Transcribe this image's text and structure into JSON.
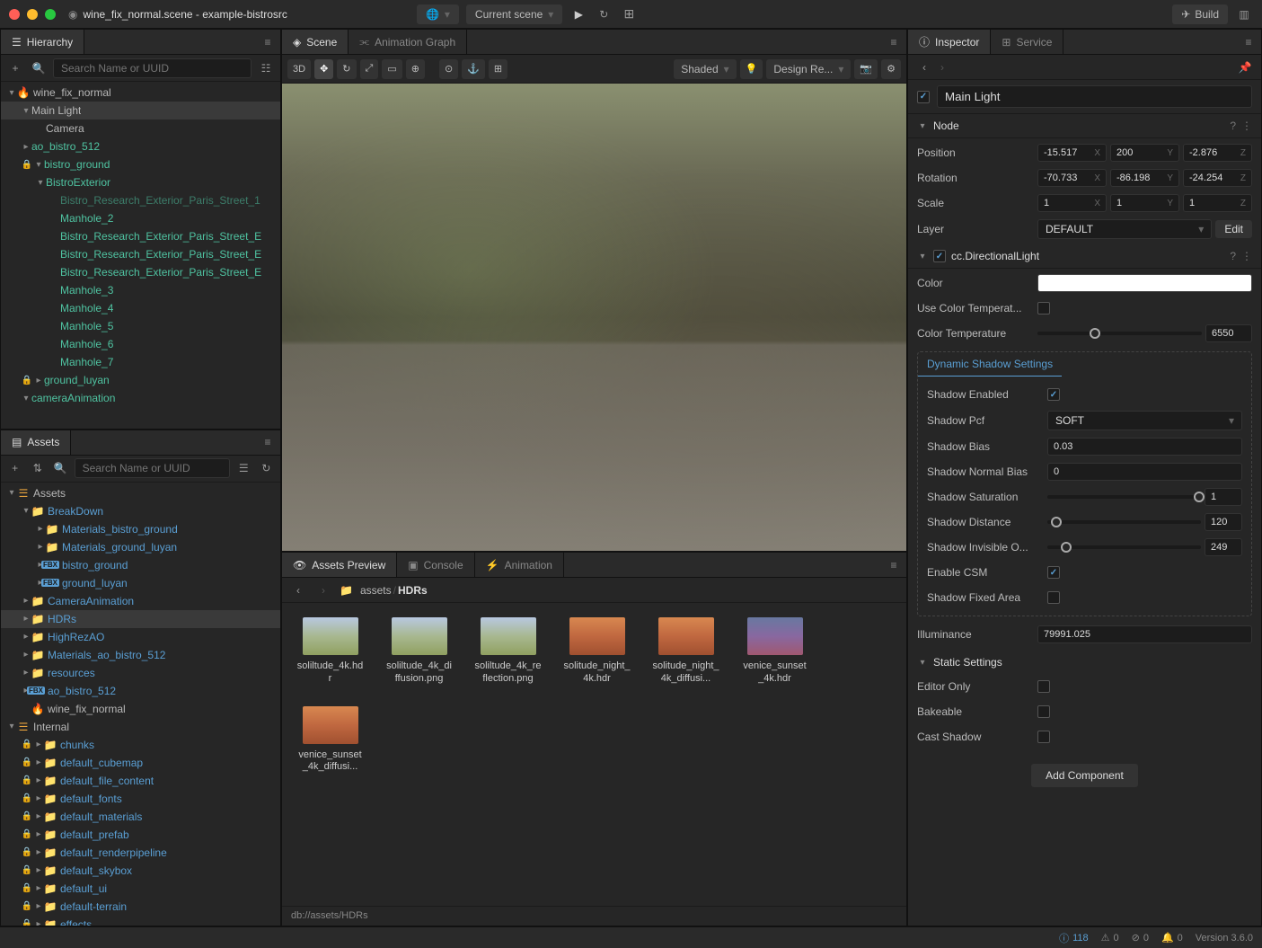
{
  "titlebar": {
    "filename": "wine_fix_normal.scene - example-bistrosrc",
    "scene_dd": "Current scene",
    "build": "Build"
  },
  "hierarchy": {
    "title": "Hierarchy",
    "search_placeholder": "Search Name or UUID",
    "items": [
      {
        "label": "wine_fix_normal",
        "depth": 0,
        "caret": "v",
        "icon": "flame",
        "color": ""
      },
      {
        "label": "Main Light",
        "depth": 1,
        "caret": "v",
        "icon": "",
        "color": "",
        "selected": true
      },
      {
        "label": "Camera",
        "depth": 2,
        "caret": "",
        "icon": "",
        "color": ""
      },
      {
        "label": "ao_bistro_512",
        "depth": 1,
        "caret": ">",
        "icon": "",
        "color": "teal"
      },
      {
        "label": "bistro_ground",
        "depth": 1,
        "caret": "v",
        "icon": "",
        "color": "teal",
        "lock": true
      },
      {
        "label": "BistroExterior",
        "depth": 2,
        "caret": "v",
        "icon": "",
        "color": "teal"
      },
      {
        "label": "Bistro_Research_Exterior_Paris_Street_1",
        "depth": 3,
        "caret": "",
        "icon": "",
        "color": "teal dim"
      },
      {
        "label": "Manhole_2",
        "depth": 3,
        "caret": "",
        "icon": "",
        "color": "teal"
      },
      {
        "label": "Bistro_Research_Exterior_Paris_Street_E",
        "depth": 3,
        "caret": "",
        "icon": "",
        "color": "teal"
      },
      {
        "label": "Bistro_Research_Exterior_Paris_Street_E",
        "depth": 3,
        "caret": "",
        "icon": "",
        "color": "teal"
      },
      {
        "label": "Bistro_Research_Exterior_Paris_Street_E",
        "depth": 3,
        "caret": "",
        "icon": "",
        "color": "teal"
      },
      {
        "label": "Manhole_3",
        "depth": 3,
        "caret": "",
        "icon": "",
        "color": "teal"
      },
      {
        "label": "Manhole_4",
        "depth": 3,
        "caret": "",
        "icon": "",
        "color": "teal"
      },
      {
        "label": "Manhole_5",
        "depth": 3,
        "caret": "",
        "icon": "",
        "color": "teal"
      },
      {
        "label": "Manhole_6",
        "depth": 3,
        "caret": "",
        "icon": "",
        "color": "teal"
      },
      {
        "label": "Manhole_7",
        "depth": 3,
        "caret": "",
        "icon": "",
        "color": "teal"
      },
      {
        "label": "ground_luyan",
        "depth": 1,
        "caret": ">",
        "icon": "",
        "color": "teal",
        "lock": true
      },
      {
        "label": "cameraAnimation",
        "depth": 1,
        "caret": "v",
        "icon": "",
        "color": "teal"
      }
    ]
  },
  "assets": {
    "title": "Assets",
    "search_placeholder": "Search Name or UUID",
    "items": [
      {
        "label": "Assets",
        "depth": 0,
        "caret": "v",
        "icon": "db",
        "color": ""
      },
      {
        "label": "BreakDown",
        "depth": 1,
        "caret": "v",
        "icon": "folder",
        "color": "blue"
      },
      {
        "label": "Materials_bistro_ground",
        "depth": 2,
        "caret": ">",
        "icon": "folder",
        "color": "blue"
      },
      {
        "label": "Materials_ground_luyan",
        "depth": 2,
        "caret": ">",
        "icon": "folder",
        "color": "blue"
      },
      {
        "label": "bistro_ground",
        "depth": 2,
        "caret": ">",
        "icon": "fbx",
        "color": "blue"
      },
      {
        "label": "ground_luyan",
        "depth": 2,
        "caret": ">",
        "icon": "fbx",
        "color": "blue"
      },
      {
        "label": "CameraAnimation",
        "depth": 1,
        "caret": ">",
        "icon": "folder",
        "color": "blue"
      },
      {
        "label": "HDRs",
        "depth": 1,
        "caret": ">",
        "icon": "folder",
        "color": "blue",
        "selected": true
      },
      {
        "label": "HighRezAO",
        "depth": 1,
        "caret": ">",
        "icon": "folder",
        "color": "blue"
      },
      {
        "label": "Materials_ao_bistro_512",
        "depth": 1,
        "caret": ">",
        "icon": "folder",
        "color": "blue"
      },
      {
        "label": "resources",
        "depth": 1,
        "caret": ">",
        "icon": "folder",
        "color": "blue"
      },
      {
        "label": "ao_bistro_512",
        "depth": 1,
        "caret": ">",
        "icon": "fbx",
        "color": "blue"
      },
      {
        "label": "wine_fix_normal",
        "depth": 1,
        "caret": "",
        "icon": "flame",
        "color": ""
      },
      {
        "label": "Internal",
        "depth": 0,
        "caret": "v",
        "icon": "db",
        "color": ""
      },
      {
        "label": "chunks",
        "depth": 1,
        "caret": ">",
        "icon": "folder",
        "color": "blue",
        "lock": true
      },
      {
        "label": "default_cubemap",
        "depth": 1,
        "caret": ">",
        "icon": "folder",
        "color": "blue",
        "lock": true
      },
      {
        "label": "default_file_content",
        "depth": 1,
        "caret": ">",
        "icon": "folder",
        "color": "blue",
        "lock": true
      },
      {
        "label": "default_fonts",
        "depth": 1,
        "caret": ">",
        "icon": "folder",
        "color": "blue",
        "lock": true
      },
      {
        "label": "default_materials",
        "depth": 1,
        "caret": ">",
        "icon": "folder",
        "color": "blue",
        "lock": true
      },
      {
        "label": "default_prefab",
        "depth": 1,
        "caret": ">",
        "icon": "folder",
        "color": "blue",
        "lock": true
      },
      {
        "label": "default_renderpipeline",
        "depth": 1,
        "caret": ">",
        "icon": "folder",
        "color": "blue",
        "lock": true
      },
      {
        "label": "default_skybox",
        "depth": 1,
        "caret": ">",
        "icon": "folder",
        "color": "blue",
        "lock": true
      },
      {
        "label": "default_ui",
        "depth": 1,
        "caret": ">",
        "icon": "folder",
        "color": "blue",
        "lock": true
      },
      {
        "label": "default-terrain",
        "depth": 1,
        "caret": ">",
        "icon": "folder",
        "color": "blue",
        "lock": true
      },
      {
        "label": "effects",
        "depth": 1,
        "caret": ">",
        "icon": "folder",
        "color": "blue",
        "lock": true
      }
    ]
  },
  "center": {
    "tabs": {
      "scene": "Scene",
      "anim_graph": "Animation Graph"
    },
    "tool_3d": "3D",
    "shaded": "Shaded",
    "design": "Design Re...",
    "preview_tabs": {
      "preview": "Assets Preview",
      "console": "Console",
      "animation": "Animation"
    },
    "breadcrumb": [
      "assets",
      "HDRs"
    ],
    "grid": [
      {
        "name": "soliltude_4k.hdr",
        "thumb": "day"
      },
      {
        "name": "soliltude_4k_diffusion.png",
        "thumb": "day"
      },
      {
        "name": "soliltude_4k_reflection.png",
        "thumb": "day"
      },
      {
        "name": "solitude_night_4k.hdr",
        "thumb": "sunset"
      },
      {
        "name": "solitude_night_4k_diffusi...",
        "thumb": "sunset"
      },
      {
        "name": "venice_sunset_4k.hdr",
        "thumb": "dusk"
      },
      {
        "name": "venice_sunset_4k_diffusi...",
        "thumb": "sunset"
      }
    ],
    "path": "db://assets/HDRs"
  },
  "inspector": {
    "tabs": {
      "inspector": "Inspector",
      "service": "Service"
    },
    "name": "Main Light",
    "node_title": "Node",
    "position": {
      "label": "Position",
      "x": "-15.517",
      "y": "200",
      "z": "-2.876"
    },
    "rotation": {
      "label": "Rotation",
      "x": "-70.733",
      "y": "-86.198",
      "z": "-24.254"
    },
    "scale": {
      "label": "Scale",
      "x": "1",
      "y": "1",
      "z": "1"
    },
    "layer": {
      "label": "Layer",
      "value": "DEFAULT",
      "edit": "Edit"
    },
    "component": "cc.DirectionalLight",
    "color_label": "Color",
    "use_color_temp": "Use Color Temperat...",
    "color_temp": {
      "label": "Color Temperature",
      "value": "6550"
    },
    "dyn_shadow": "Dynamic Shadow Settings",
    "shadow_enabled": "Shadow Enabled",
    "shadow_pcf": {
      "label": "Shadow Pcf",
      "value": "SOFT"
    },
    "shadow_bias": {
      "label": "Shadow Bias",
      "value": "0.03"
    },
    "shadow_normal_bias": {
      "label": "Shadow Normal Bias",
      "value": "0"
    },
    "shadow_saturation": {
      "label": "Shadow Saturation",
      "value": "1"
    },
    "shadow_distance": {
      "label": "Shadow Distance",
      "value": "120"
    },
    "shadow_invisible": {
      "label": "Shadow Invisible O...",
      "value": "249"
    },
    "enable_csm": "Enable CSM",
    "shadow_fixed": "Shadow Fixed Area",
    "illuminance": {
      "label": "Illuminance",
      "value": "79991.025"
    },
    "static_title": "Static Settings",
    "editor_only": "Editor Only",
    "bakeable": "Bakeable",
    "cast_shadow": "Cast Shadow",
    "add_component": "Add Component"
  },
  "status": {
    "info": "118",
    "warn": "0",
    "err": "0",
    "notif": "0",
    "version": "Version 3.6.0"
  }
}
